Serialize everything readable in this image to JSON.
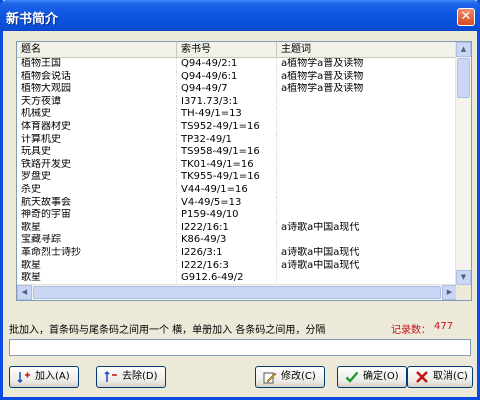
{
  "window": {
    "title": "新书简介",
    "close_glyph": "✕"
  },
  "table": {
    "columns": [
      "题名",
      "索书号",
      "主题词"
    ],
    "rows": [
      [
        "植物王国",
        "Q94-49/2:1",
        "a植物学a普及读物"
      ],
      [
        "植物会说话",
        "Q94-49/6:1",
        "a植物学a普及读物"
      ],
      [
        "植物大观园",
        "Q94-49/7",
        "a植物学a普及读物"
      ],
      [
        "天方夜谭",
        "I371.73/3:1",
        ""
      ],
      [
        "机械史",
        "TH-49/1=13",
        ""
      ],
      [
        "体育器材史",
        "TS952-49/1=16",
        ""
      ],
      [
        "计算机史",
        "TP32-49/1",
        ""
      ],
      [
        "玩具史",
        "TS958-49/1=16",
        ""
      ],
      [
        "铁路开发史",
        "TK01-49/1=16",
        ""
      ],
      [
        "罗盘史",
        "TK955-49/1=16",
        ""
      ],
      [
        "杀史",
        "V44-49/1=16",
        ""
      ],
      [
        "航天故事会",
        "V4-49/5=13",
        ""
      ],
      [
        "神奇的宇宙",
        "P159-49/10",
        ""
      ],
      [
        "歌星",
        "I222/16:1",
        "a诗歌a中国a现代"
      ],
      [
        "宝藏寻踪",
        "K86-49/3",
        ""
      ],
      [
        "革命烈士诗抄",
        "I226/3:1",
        "a诗歌a中国a现代"
      ],
      [
        "歌星",
        "I222/16:3",
        "a诗歌a中国a现代"
      ],
      [
        "歌星",
        "G912.6-49/2",
        ""
      ]
    ]
  },
  "footer": {
    "hint": "批加入，首条码与尾条码之间用一个 横，单册加入 各条码之间用，分隔",
    "record_label": "记录数：",
    "record_count": "477",
    "input_value": ""
  },
  "buttons": {
    "add": "加入(A)",
    "remove": "去除(D)",
    "edit": "修改(C)",
    "ok": "确定(O)",
    "cancel": "取消(C)"
  }
}
